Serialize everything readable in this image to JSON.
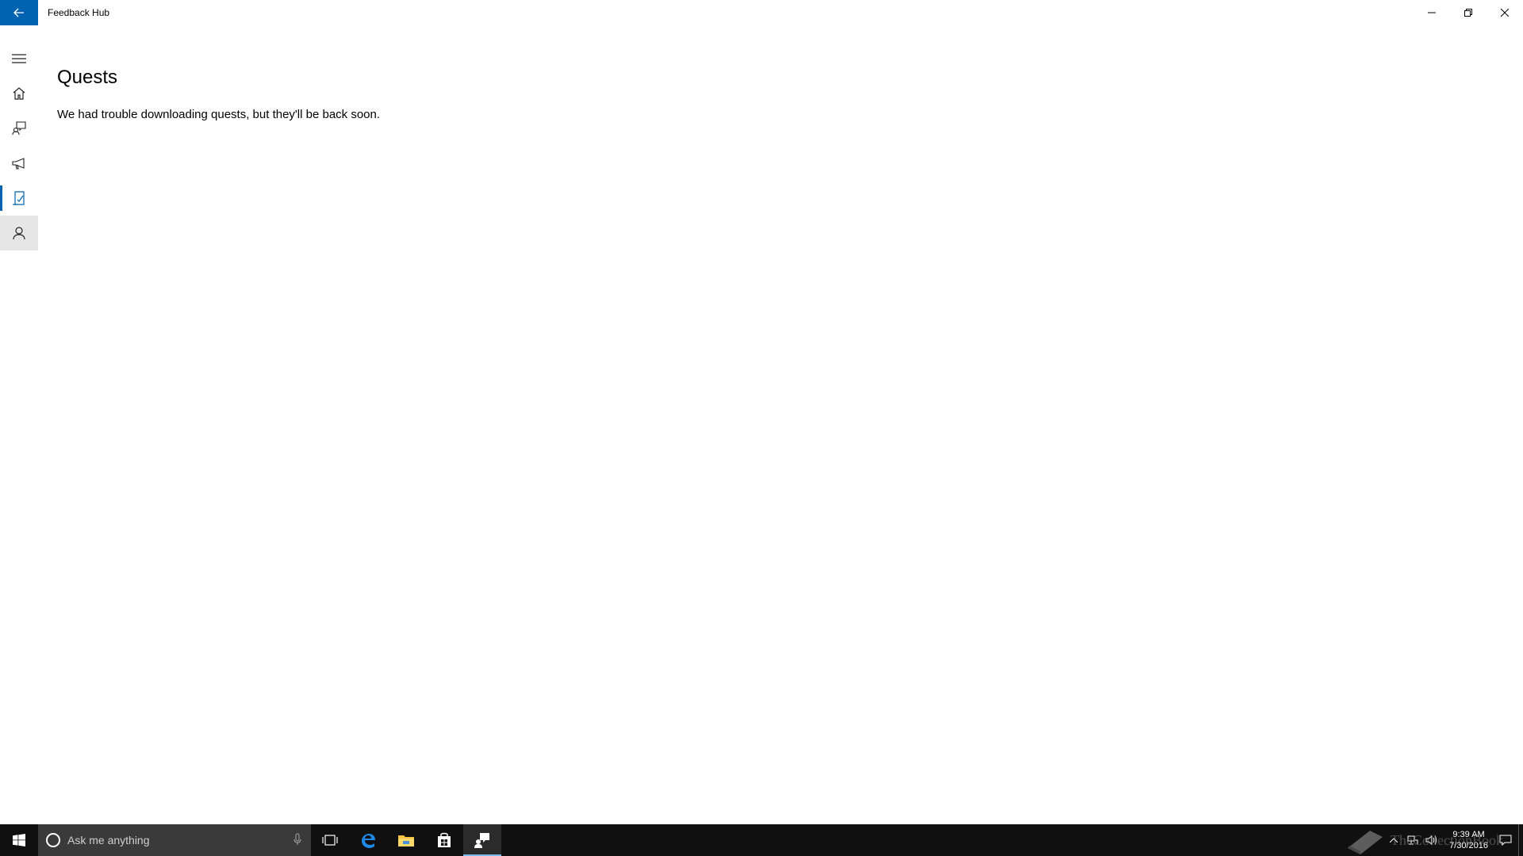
{
  "window": {
    "title": "Feedback Hub"
  },
  "nav": {
    "items": [
      {
        "name": "menu"
      },
      {
        "name": "home"
      },
      {
        "name": "feedback"
      },
      {
        "name": "announcements"
      },
      {
        "name": "quests",
        "selected": true
      },
      {
        "name": "profile"
      }
    ]
  },
  "main": {
    "title": "Quests",
    "message": "We had trouble downloading quests, but they'll be back soon."
  },
  "taskbar": {
    "search_placeholder": "Ask me anything",
    "clock_time": "9:39 AM",
    "clock_date": "7/30/2016",
    "watermark": "TheCollectionBook"
  },
  "colors": {
    "accent": "#0063b1",
    "taskbar_bg": "#101010",
    "taskbar_active_underline": "#76b9ed"
  }
}
